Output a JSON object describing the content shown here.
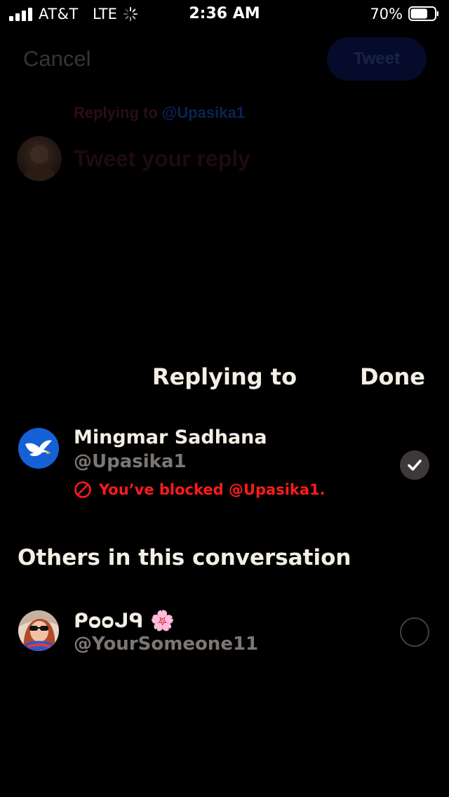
{
  "status_bar": {
    "carrier": "AT&T",
    "network": "LTE",
    "time": "2:36 AM",
    "battery_percent": "70%",
    "battery_level": 0.7
  },
  "compose": {
    "cancel_label": "Cancel",
    "tweet_label": "Tweet",
    "replying_prefix": "Replying to",
    "replying_handle": "@Upasika1",
    "placeholder": "Tweet your reply"
  },
  "sheet": {
    "title": "Replying to",
    "done_label": "Done"
  },
  "primary_user": {
    "name": "Mingmar Sadhana",
    "handle": "@Upasika1",
    "blocked_message": "You’ve blocked @Upasika1.",
    "selected": true
  },
  "others": {
    "heading": "Others in this conversation",
    "users": [
      {
        "name": "ᑭᴑᴑᒍᑫ 🌸",
        "handle": "@YourSomeone11",
        "selected": false
      }
    ]
  },
  "colors": {
    "background": "#000000",
    "text_primary": "#f4efe5",
    "text_secondary": "#7d7774",
    "error": "#ff1b1b",
    "check_fill": "#3f3838"
  }
}
